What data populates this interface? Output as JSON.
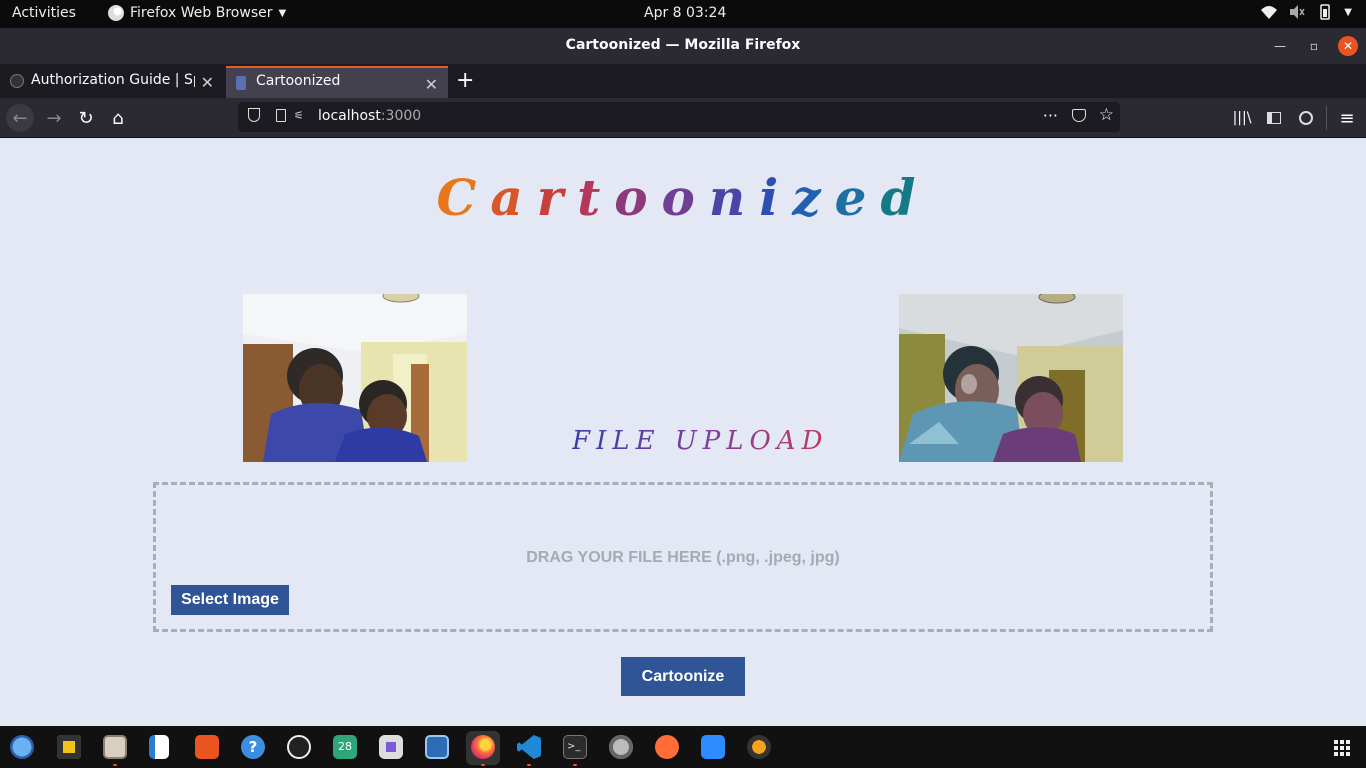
{
  "topbar": {
    "activities": "Activities",
    "app_name": "Firefox Web Browser",
    "clock": "Apr 8  03:24"
  },
  "window": {
    "title": "Cartoonized — Mozilla Firefox"
  },
  "tabs": [
    {
      "label": "Authorization Guide | Spotify",
      "active": false
    },
    {
      "label": "Cartoonized",
      "active": true
    }
  ],
  "urlbar": {
    "host": "localhost",
    "port": ":3000"
  },
  "page": {
    "brand": [
      "C",
      "a",
      "r",
      "t",
      "o",
      "o",
      "n",
      "i",
      "z",
      "e",
      "d"
    ],
    "brand_colors": [
      "#e8761a",
      "#d7562a",
      "#c8403b",
      "#b4385a",
      "#8d3a7c",
      "#6e3f94",
      "#4b45a6",
      "#2f4fb2",
      "#2560b0",
      "#1f6fa2",
      "#157a88"
    ],
    "upload_title": "FILE UPLOAD",
    "drop_text": "DRAG YOUR FILE HERE (.png, .jpeg, jpg)",
    "select_button": "Select Image",
    "cartoonize_button": "Cartoonize",
    "photos": {
      "original_alt": "original-photo",
      "cartoon_alt": "cartoonized-photo"
    }
  },
  "dock": {
    "icons": [
      "thunderbird-icon",
      "rhythmbox-icon",
      "files-icon",
      "writer-icon",
      "software-icon",
      "help-icon",
      "obs-icon",
      "calendar-icon",
      "screenshot-icon",
      "app-icon",
      "firefox-icon",
      "vscode-icon",
      "terminal-icon",
      "settings-icon",
      "postman-icon",
      "zoom-icon",
      "flstudio-icon"
    ],
    "calendar_day": "28"
  },
  "colors": {
    "accent": "#2f5597",
    "ubuntu_orange": "#e95420",
    "page_bg": "#e3e8f4"
  }
}
